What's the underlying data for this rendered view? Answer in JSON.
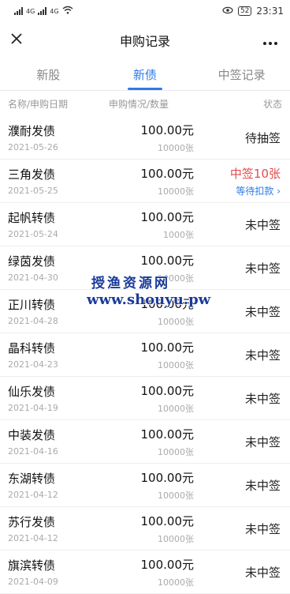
{
  "status_bar": {
    "time": "23:31",
    "battery": "52",
    "network_tags": [
      "4G",
      "4G"
    ]
  },
  "nav": {
    "title": "申购记录",
    "close_icon": "close-icon",
    "more_icon": "more-icon"
  },
  "tabs": [
    {
      "label": "新股",
      "active": false
    },
    {
      "label": "新债",
      "active": true
    },
    {
      "label": "中签记录",
      "active": false
    }
  ],
  "columns": {
    "name_date": "名称/申购日期",
    "status_qty": "申购情况/数量",
    "state": "状态"
  },
  "rows": [
    {
      "name": "濮耐发债",
      "date": "2021-05-26",
      "amount": "100.00元",
      "count": "10000张",
      "status": "待抽签",
      "status_type": "pending",
      "link": ""
    },
    {
      "name": "三角发债",
      "date": "2021-05-25",
      "amount": "100.00元",
      "count": "10000张",
      "status": "中签10张",
      "status_type": "win",
      "link": "等待扣款 ›"
    },
    {
      "name": "起帆转债",
      "date": "2021-05-24",
      "amount": "100.00元",
      "count": "1000张",
      "status": "未中签",
      "status_type": "miss",
      "link": ""
    },
    {
      "name": "绿茵发债",
      "date": "2021-04-30",
      "amount": "100.00元",
      "count": "10000张",
      "status": "未中签",
      "status_type": "miss",
      "link": ""
    },
    {
      "name": "正川转债",
      "date": "2021-04-28",
      "amount": "100.00元",
      "count": "10000张",
      "status": "未中签",
      "status_type": "miss",
      "link": ""
    },
    {
      "name": "晶科转债",
      "date": "2021-04-23",
      "amount": "100.00元",
      "count": "10000张",
      "status": "未中签",
      "status_type": "miss",
      "link": ""
    },
    {
      "name": "仙乐发债",
      "date": "2021-04-19",
      "amount": "100.00元",
      "count": "10000张",
      "status": "未中签",
      "status_type": "miss",
      "link": ""
    },
    {
      "name": "中装发债",
      "date": "2021-04-16",
      "amount": "100.00元",
      "count": "10000张",
      "status": "未中签",
      "status_type": "miss",
      "link": ""
    },
    {
      "name": "东湖转债",
      "date": "2021-04-12",
      "amount": "100.00元",
      "count": "10000张",
      "status": "未中签",
      "status_type": "miss",
      "link": ""
    },
    {
      "name": "苏行发债",
      "date": "2021-04-12",
      "amount": "100.00元",
      "count": "10000张",
      "status": "未中签",
      "status_type": "miss",
      "link": ""
    },
    {
      "name": "旗滨转债",
      "date": "2021-04-09",
      "amount": "100.00元",
      "count": "10000张",
      "status": "未中签",
      "status_type": "miss",
      "link": ""
    }
  ],
  "watermark": {
    "line1": "授渔资源网",
    "line2": "www.shouyu.pw"
  },
  "colors": {
    "accent": "#2f7be8",
    "win": "#e24b4b"
  }
}
